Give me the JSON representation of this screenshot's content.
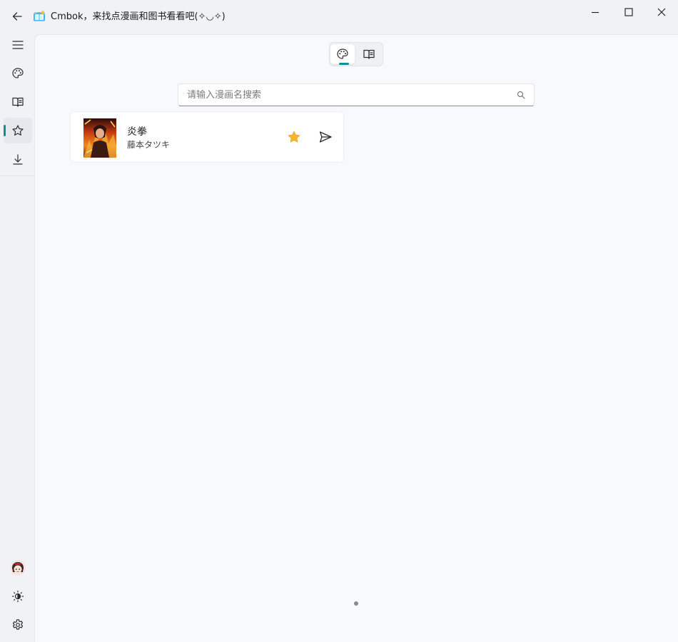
{
  "window": {
    "title": "Cmbok，来找点漫画和图书看看吧(✧◡✧)",
    "controls": [
      "minimize-icon",
      "maximize-icon",
      "close-icon"
    ]
  },
  "sidebar": {
    "items": [
      {
        "name": "menu",
        "icon": "hamburger-menu-icon"
      },
      {
        "name": "comics",
        "icon": "palette-icon"
      },
      {
        "name": "books",
        "icon": "open-book-icon"
      },
      {
        "name": "favorites",
        "icon": "star-outline-icon",
        "active": true
      },
      {
        "name": "downloads",
        "icon": "download-icon"
      }
    ],
    "bottom": [
      {
        "name": "avatar",
        "icon": "avatar-icon"
      },
      {
        "name": "theme",
        "icon": "brightness-icon"
      },
      {
        "name": "settings",
        "icon": "gear-icon"
      }
    ]
  },
  "segmented": {
    "options": [
      "palette-icon",
      "open-book-icon"
    ],
    "selected": "palette-icon"
  },
  "search": {
    "placeholder": "请输入漫画名搜索",
    "value": ""
  },
  "results": [
    {
      "title": "炎拳",
      "author": "藤本タツキ",
      "favorited": true
    }
  ],
  "colors": {
    "accent": "#0f8f93",
    "star": "#f7b52c",
    "background": "#f7f9fc"
  },
  "pagination": {
    "current": 1
  }
}
